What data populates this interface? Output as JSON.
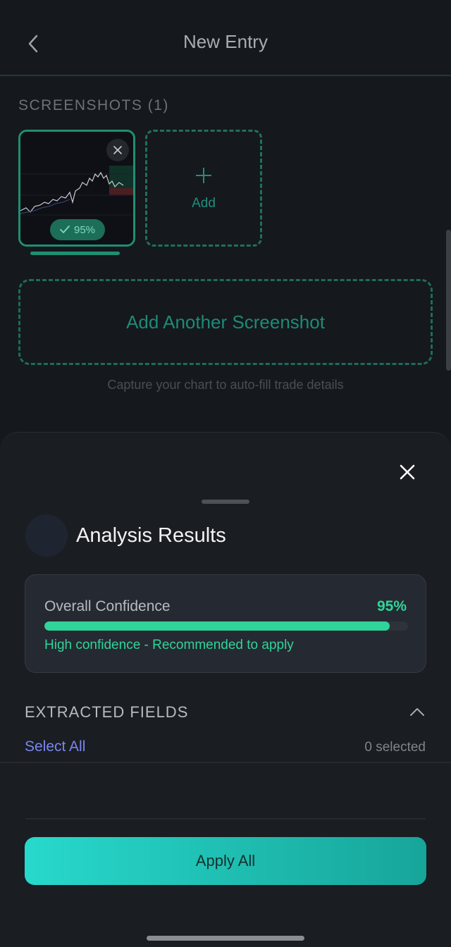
{
  "header": {
    "title": "New Entry"
  },
  "screenshots": {
    "section_label": "SCREENSHOTS (1)",
    "thumbnail": {
      "badge": "95%"
    },
    "add_tile_label": "Add",
    "add_another_label": "Add Another Screenshot",
    "hint": "Capture your chart to auto-fill trade details"
  },
  "sheet": {
    "title": "Analysis Results",
    "confidence": {
      "label": "Overall Confidence",
      "value_text": "95%",
      "value": 0.95,
      "note": "High confidence - Recommended to apply"
    },
    "fields": {
      "label": "EXTRACTED FIELDS",
      "select_all": "Select All",
      "selected_count": "0 selected"
    },
    "apply_label": "Apply All"
  },
  "colors": {
    "accent": "#2fd49a",
    "teal": "#1f8f72",
    "link": "#7a86f0",
    "apply_gradient_start": "#27d9cc"
  },
  "icons": [
    "back-chevron-icon",
    "close-icon",
    "check-icon",
    "plus-icon",
    "chevron-up-icon"
  ]
}
